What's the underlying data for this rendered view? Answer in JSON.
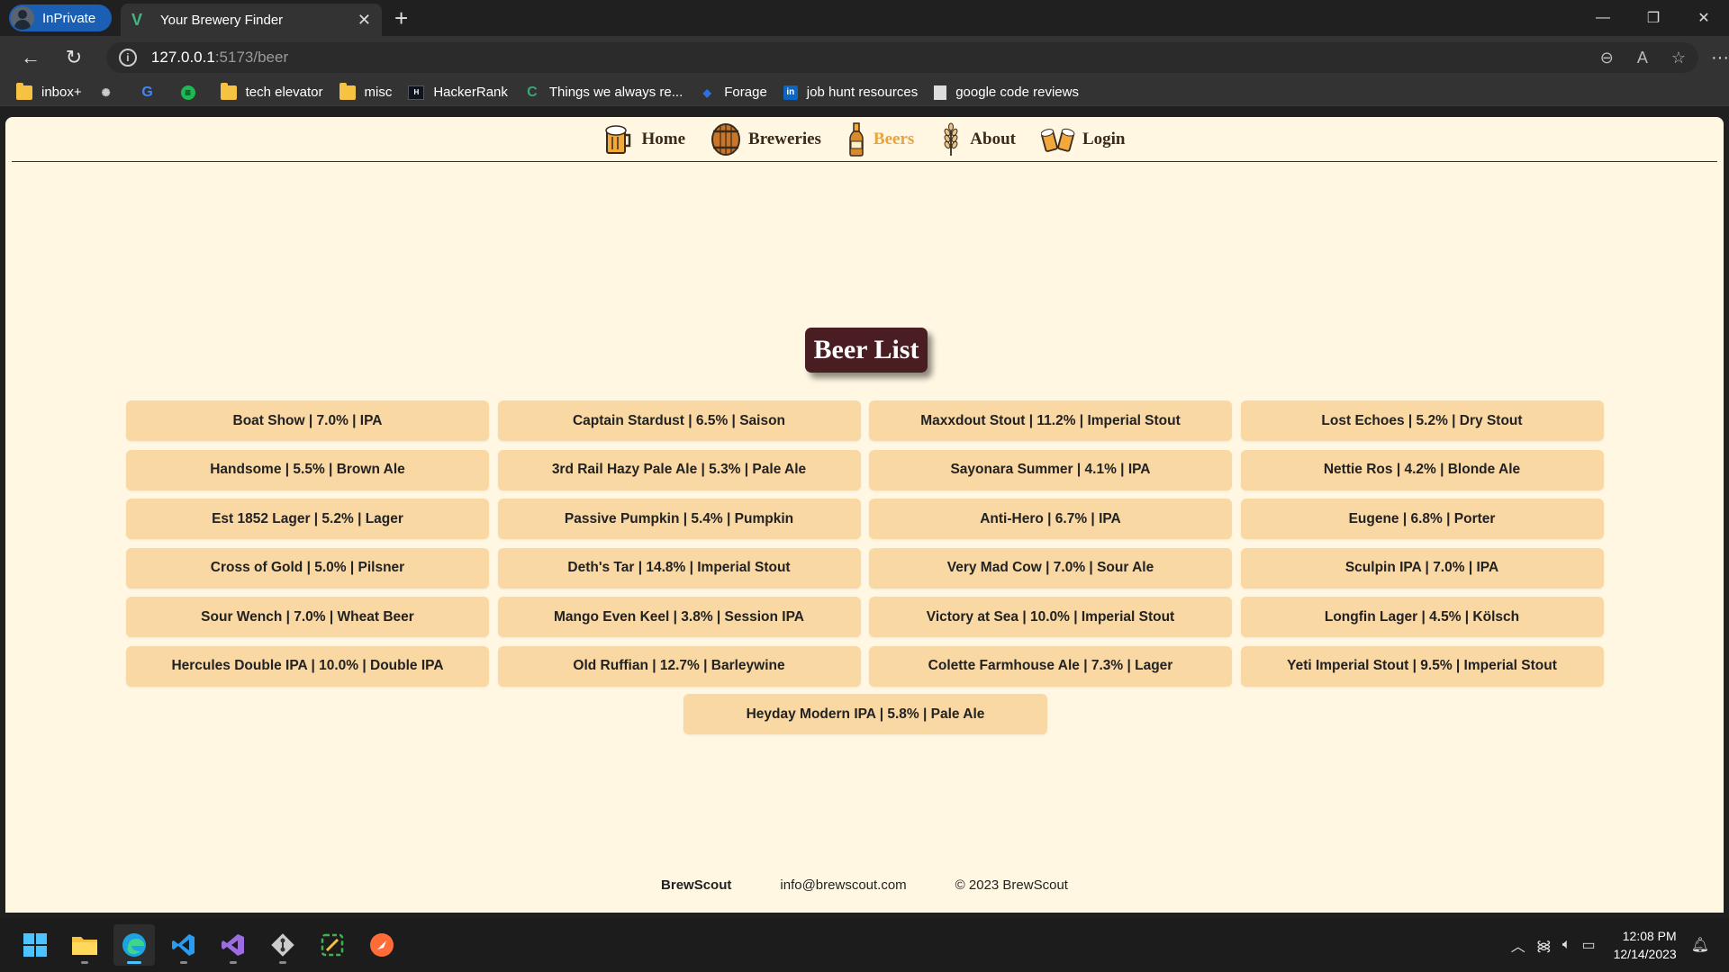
{
  "browser": {
    "inprivate_label": "InPrivate",
    "tab_title": "Your Brewery Finder",
    "url_host": "127.0.0.1",
    "url_path": ":5173/beer",
    "bookmarks": [
      {
        "label": "inbox+",
        "icon": "folder-icon"
      },
      {
        "label": "",
        "icon": "chatgpt-icon"
      },
      {
        "label": "",
        "icon": "google-icon"
      },
      {
        "label": "",
        "icon": "spotify-icon"
      },
      {
        "label": "tech elevator",
        "icon": "folder-icon"
      },
      {
        "label": "misc",
        "icon": "folder-icon"
      },
      {
        "label": "HackerRank",
        "icon": "hackerrank-icon"
      },
      {
        "label": "Things we always re...",
        "icon": "site-icon"
      },
      {
        "label": "Forage",
        "icon": "forage-icon"
      },
      {
        "label": "job hunt resources",
        "icon": "linkedin-icon"
      },
      {
        "label": "google code reviews",
        "icon": "page-icon"
      }
    ]
  },
  "nav": {
    "home": "Home",
    "breweries": "Breweries",
    "beers": "Beers",
    "about": "About",
    "login": "Login",
    "active": "beers"
  },
  "main": {
    "title": "Beer List",
    "beers": [
      "Boat Show | 7.0% | IPA",
      "Captain Stardust | 6.5% | Saison",
      "Maxxdout Stout | 11.2% | Imperial Stout",
      "Lost Echoes | 5.2% | Dry Stout",
      "Handsome | 5.5% | Brown Ale",
      "3rd Rail Hazy Pale Ale | 5.3% | Pale Ale",
      "Sayonara Summer | 4.1% | IPA",
      "Nettie Ros | 4.2% | Blonde Ale",
      "Est 1852 Lager | 5.2% | Lager",
      "Passive Pumpkin | 5.4% | Pumpkin",
      "Anti-Hero | 6.7% | IPA",
      "Eugene | 6.8% | Porter",
      "Cross of Gold | 5.0% | Pilsner",
      "Deth's Tar | 14.8% | Imperial Stout",
      "Very Mad Cow | 7.0% | Sour Ale",
      "Sculpin IPA | 7.0% | IPA",
      "Sour Wench | 7.0% | Wheat Beer",
      "Mango Even Keel | 3.8% | Session IPA",
      "Victory at Sea | 10.0% | Imperial Stout",
      "Longfin Lager | 4.5% | Kölsch",
      "Hercules Double IPA | 10.0% | Double IPA",
      "Old Ruffian | 12.7% | Barleywine",
      "Colette Farmhouse Ale | 7.3% | Lager",
      "Yeti Imperial Stout | 9.5% | Imperial Stout"
    ],
    "last_beer": "Heyday Modern IPA | 5.8% | Pale Ale"
  },
  "footer": {
    "brand": "BrewScout",
    "email": "info@brewscout.com",
    "copyright": "© 2023 BrewScout"
  },
  "taskbar": {
    "time": "12:08 PM",
    "date": "12/14/2023"
  },
  "colors": {
    "page_bg": "#fff7e2",
    "card_bg": "#f9d8a4",
    "title_bg": "#4a1d22",
    "active_nav": "#e8a33d"
  }
}
